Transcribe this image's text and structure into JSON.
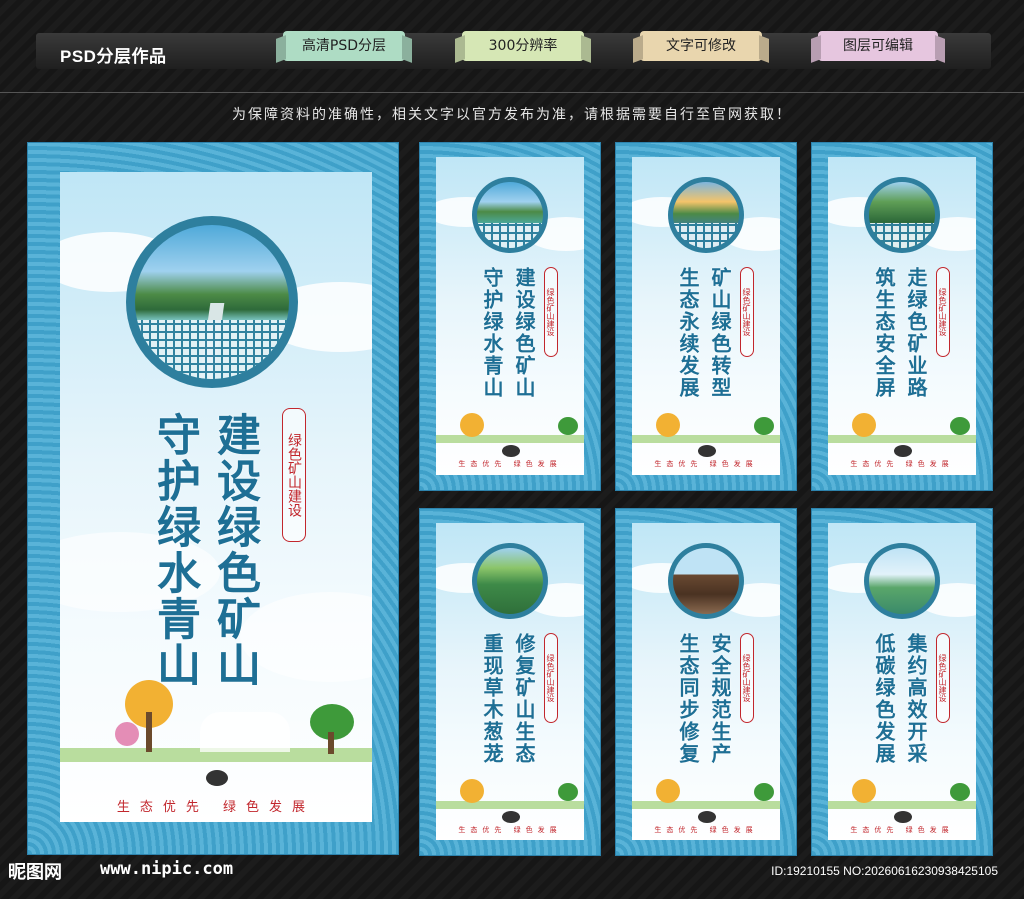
{
  "header": {
    "title": "PSD分层作品",
    "tags": [
      "高清PSD分层",
      "300分辨率",
      "文字可修改",
      "图层可编辑"
    ],
    "notice": "为保障资料的准确性，相关文字以官方发布为准，请根据需要自行至官网获取！"
  },
  "seal_text": "绿色矿山建设",
  "footer_text": "生态优先  绿色发展",
  "panels": [
    {
      "col1": "守护绿水青山",
      "col2": "建设绿色矿山"
    },
    {
      "col1": "守护绿水青山",
      "col2": "建设绿色矿山"
    },
    {
      "col1": "生态永续发展",
      "col2": "矿山绿色转型"
    },
    {
      "col1": "筑生态安全屏",
      "col2": "走绿色矿业路"
    },
    {
      "col1": "重现草木葱茏",
      "col2": "修复矿山生态"
    },
    {
      "col1": "生态同步修复",
      "col2": "安全规范生产"
    },
    {
      "col1": "低碳绿色发展",
      "col2": "集约高效开采"
    }
  ],
  "watermark": {
    "brand": "昵图网",
    "url": "www.nipic.com",
    "id": "ID:19210155 NO:20260616230938425105"
  }
}
